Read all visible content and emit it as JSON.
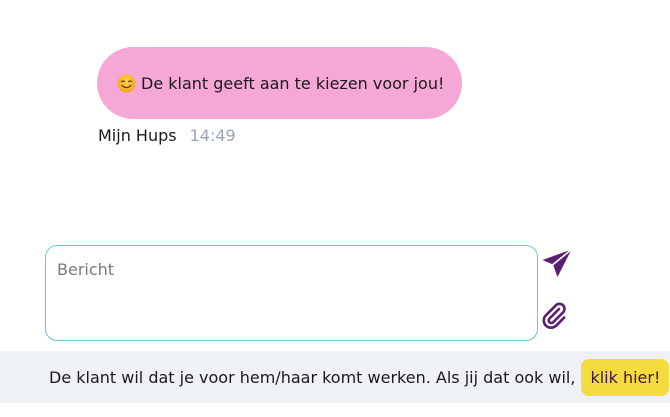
{
  "chat": {
    "message": {
      "emoji_icon": "smiling-face-emoji",
      "text": "De klant geeft aan te kiezen voor jou!",
      "sender": "Mijn Hups",
      "time": "14:49"
    }
  },
  "composer": {
    "placeholder": "Bericht",
    "value": "",
    "send_icon": "paper-plane-icon",
    "attach_icon": "paperclip-icon"
  },
  "footer": {
    "text": "De klant wil dat je voor hem/haar komt werken. Als jij dat ook wil,",
    "cta_label": "klik hier!"
  },
  "colors": {
    "bubble": "#f5a8d6",
    "accent_purple": "#5a1e73",
    "input_border": "#6cc6d9",
    "cta_yellow": "#f4dc3e",
    "footer_bg": "#eef2f7",
    "time_text": "#9aa4b6"
  }
}
